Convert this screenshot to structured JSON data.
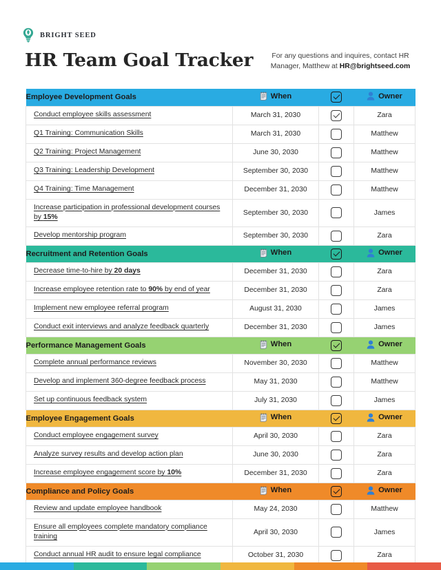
{
  "brand": {
    "name": "BRIGHT SEED",
    "logo_icon": "lightbulb-leaf-icon",
    "logo_color": "#34a893"
  },
  "header": {
    "title": "HR Team Goal Tracker",
    "contact_line1": "For any questions and inquires, contact HR",
    "contact_line2_prefix": "Manager, Matthew at ",
    "contact_email": "HR@brightseed.com"
  },
  "columns": {
    "when_label": "When",
    "when_icon": "notepad-icon",
    "owner_label": "Owner",
    "owner_icon": "person-icon",
    "check_icon": "checkbox-checked-icon"
  },
  "colors": {
    "section1": "#29abe2",
    "section2": "#2bb99b",
    "section3": "#96d272",
    "section4": "#f0b73f",
    "section5": "#ef8a29",
    "footer": [
      "#29abe2",
      "#2bb99b",
      "#96d272",
      "#f0b73f",
      "#ef8a29",
      "#e85a45"
    ]
  },
  "sections": [
    {
      "title": "Employee Development Goals",
      "color": "#29abe2",
      "rows": [
        {
          "goal": "Conduct employee skills assessment",
          "goal_bold": "",
          "when": "March 31, 2030",
          "checked": true,
          "owner": "Zara"
        },
        {
          "goal": "Q1 Training: Communication Skills",
          "goal_bold": "",
          "when": "March 31, 2030",
          "checked": false,
          "owner": "Matthew"
        },
        {
          "goal": "Q2 Training: Project Management",
          "goal_bold": "",
          "when": "June 30, 2030",
          "checked": false,
          "owner": "Matthew"
        },
        {
          "goal": "Q3 Training: Leadership Development",
          "goal_bold": "",
          "when": "September 30, 2030",
          "checked": false,
          "owner": "Matthew"
        },
        {
          "goal": "Q4 Training: Time Management",
          "goal_bold": "",
          "when": "December 31, 2030",
          "checked": false,
          "owner": "Matthew"
        },
        {
          "goal": "Increase participation in professional development courses by ",
          "goal_bold": "15%",
          "when": "September 30, 2030",
          "checked": false,
          "owner": "James"
        },
        {
          "goal": "Develop mentorship program",
          "goal_bold": "",
          "when": "September 30, 2030",
          "checked": false,
          "owner": "Zara"
        }
      ]
    },
    {
      "title": "Recruitment and Retention Goals",
      "color": "#2bb99b",
      "rows": [
        {
          "goal": "Decrease time-to-hire by ",
          "goal_bold": "20 days",
          "when": "December 31, 2030",
          "checked": false,
          "owner": "Zara"
        },
        {
          "goal": "Increase employee retention rate to ",
          "goal_bold": "90%",
          "goal_after": " by end of year",
          "when": "December 31, 2030",
          "checked": false,
          "owner": "Zara"
        },
        {
          "goal": "Implement new employee referral program",
          "goal_bold": "",
          "when": "August 31, 2030",
          "checked": false,
          "owner": "James"
        },
        {
          "goal": "Conduct exit interviews and analyze feedback quarterly",
          "goal_bold": "",
          "when": "December 31, 2030",
          "checked": false,
          "owner": "James"
        }
      ]
    },
    {
      "title": "Performance Management Goals",
      "color": "#96d272",
      "rows": [
        {
          "goal": "Complete annual performance reviews",
          "goal_bold": "",
          "when": "November 30, 2030",
          "checked": false,
          "owner": "Matthew"
        },
        {
          "goal": "Develop and implement 360-degree feedback process",
          "goal_bold": "",
          "when": "May 31, 2030",
          "checked": false,
          "owner": "Matthew"
        },
        {
          "goal": "Set up continuous feedback system",
          "goal_bold": "",
          "when": "July 31, 2030",
          "checked": false,
          "owner": "James"
        }
      ]
    },
    {
      "title": "Employee Engagement Goals",
      "color": "#f0b73f",
      "rows": [
        {
          "goal": "Conduct employee engagement survey",
          "goal_bold": "",
          "when": "April 30, 2030",
          "checked": false,
          "owner": "Zara"
        },
        {
          "goal": "Analyze survey results and develop action plan",
          "goal_bold": "",
          "when": "June 30, 2030",
          "checked": false,
          "owner": "Zara"
        },
        {
          "goal": "Increase employee engagement score by ",
          "goal_bold": "10%",
          "when": "December 31, 2030",
          "checked": false,
          "owner": "Zara"
        }
      ]
    },
    {
      "title": "Compliance and Policy Goals",
      "color": "#ef8a29",
      "rows": [
        {
          "goal": "Review and update employee handbook",
          "goal_bold": "",
          "when": "May 24, 2030",
          "checked": false,
          "owner": "Matthew"
        },
        {
          "goal": "Ensure all employees complete mandatory compliance training",
          "goal_bold": "",
          "when": "April 30, 2030",
          "checked": false,
          "owner": "James"
        },
        {
          "goal": "Conduct annual HR audit to ensure legal compliance",
          "goal_bold": "",
          "when": "October 31, 2030",
          "checked": false,
          "owner": "Zara"
        }
      ]
    }
  ]
}
